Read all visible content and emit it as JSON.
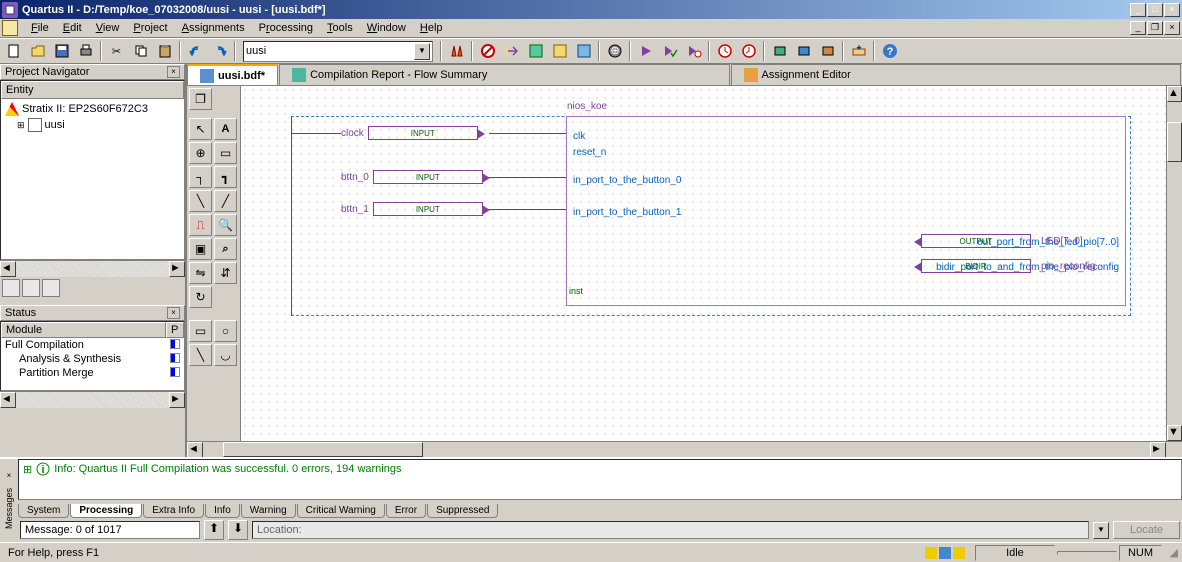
{
  "titlebar": {
    "text": "Quartus II - D:/Temp/koe_07032008/uusi - uusi - [uusi.bdf*]"
  },
  "menu": {
    "file": "File",
    "edit": "Edit",
    "view": "View",
    "project": "Project",
    "assignments": "Assignments",
    "processing": "Processing",
    "tools": "Tools",
    "window": "Window",
    "help": "Help"
  },
  "toolbar": {
    "project_combo": "uusi"
  },
  "project_navigator": {
    "title": "Project Navigator",
    "header": "Entity",
    "device": "Stratix II: EP2S60F672C3",
    "root": "uusi"
  },
  "status_panel": {
    "title": "Status",
    "col_module": "Module",
    "col_progress": "P",
    "rows": [
      {
        "name": "Full Compilation"
      },
      {
        "name": "Analysis & Synthesis",
        "indent": true
      },
      {
        "name": "Partition Merge",
        "indent": true
      }
    ]
  },
  "doc_tabs": {
    "t1": "uusi.bdf*",
    "t2": "Compilation Report - Flow Summary",
    "t3": "Assignment Editor"
  },
  "schematic": {
    "block_name": "nios_koe",
    "inst": "inst",
    "ports": {
      "clk": "clk",
      "reset_n": "reset_n",
      "btn0": "in_port_to_the_button_0",
      "btn1": "in_port_to_the_button_1",
      "led": "out_port_from_the_led_pio[7..0]",
      "bidir": "bidir_port_to_and_from_the_pio_reconfig"
    },
    "pins": {
      "clock": "clock",
      "bn0": "bttn_0",
      "bn1": "bttn_1",
      "input": "INPUT",
      "output": "OUTPUT",
      "bidir_t": "BIDIR",
      "led_out": "LED[7..0]",
      "reconfig": "pio_reconfig"
    }
  },
  "messages": {
    "sidebar_label": "Messages",
    "info_line": "Info: Quartus II Full Compilation was successful. 0 errors, 194 warnings",
    "tabs": {
      "system": "System",
      "processing": "Processing",
      "extra": "Extra Info",
      "info": "Info",
      "warning": "Warning",
      "critical": "Critical Warning",
      "error": "Error",
      "suppressed": "Suppressed"
    },
    "count": "Message: 0 of 1017",
    "location_label": "Location:",
    "locate": "Locate"
  },
  "statusbar": {
    "help": "For Help, press F1",
    "idle": "Idle",
    "num": "NUM"
  }
}
